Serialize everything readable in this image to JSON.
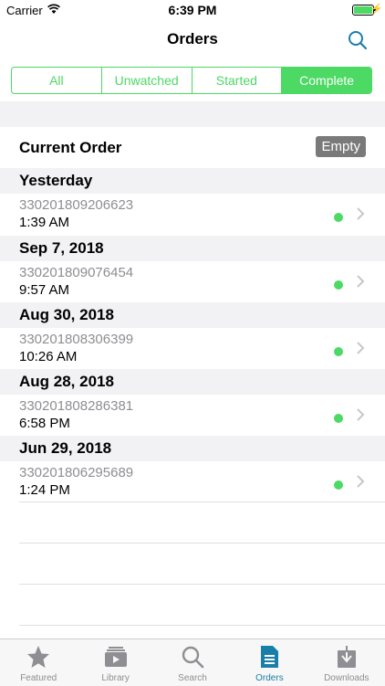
{
  "status_bar": {
    "carrier": "Carrier",
    "time": "6:39 PM"
  },
  "nav": {
    "title": "Orders"
  },
  "segments": [
    {
      "label": "All",
      "active": false
    },
    {
      "label": "Unwatched",
      "active": false
    },
    {
      "label": "Started",
      "active": false
    },
    {
      "label": "Complete",
      "active": true
    }
  ],
  "current_order": {
    "label": "Current Order",
    "badge": "Empty"
  },
  "sections": [
    {
      "header": "Yesterday",
      "order_number": "330201809206623",
      "time": "1:39 AM"
    },
    {
      "header": "Sep 7, 2018",
      "order_number": "330201809076454",
      "time": "9:57 AM"
    },
    {
      "header": "Aug 30, 2018",
      "order_number": "330201808306399",
      "time": "10:26 AM"
    },
    {
      "header": "Aug 28, 2018",
      "order_number": "330201808286381",
      "time": "6:58 PM"
    },
    {
      "header": "Jun 29, 2018",
      "order_number": "330201806295689",
      "time": "1:24 PM"
    }
  ],
  "tabs": [
    {
      "label": "Featured",
      "icon": "star-icon"
    },
    {
      "label": "Library",
      "icon": "library-icon"
    },
    {
      "label": "Search",
      "icon": "search-icon"
    },
    {
      "label": "Orders",
      "icon": "document-icon",
      "active": true
    },
    {
      "label": "Downloads",
      "icon": "download-icon"
    }
  ],
  "colors": {
    "accent_green": "#4cd964",
    "tab_active": "#1a7fa8",
    "tab_inactive": "#8e8e93",
    "badge_gray": "#7a7a7a"
  }
}
